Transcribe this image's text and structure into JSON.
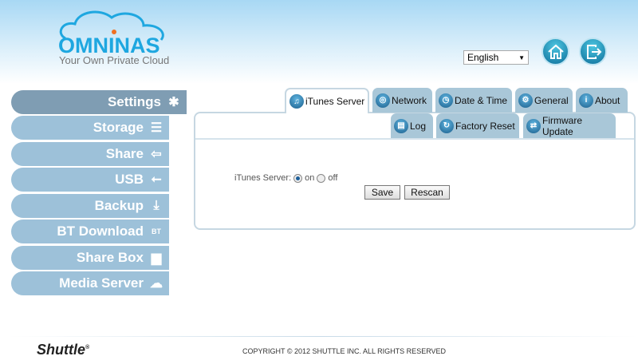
{
  "header": {
    "logo_text": "OMNINAS",
    "tagline": "Your Own Private Cloud",
    "language": "English",
    "home_icon": "home-icon",
    "logout_icon": "logout-icon"
  },
  "sidebar": {
    "items": [
      {
        "label": "Settings",
        "icon": "tools-icon",
        "active": true
      },
      {
        "label": "Storage",
        "icon": "storage-icon"
      },
      {
        "label": "Share",
        "icon": "share-arrow-icon"
      },
      {
        "label": "USB",
        "icon": "usb-icon"
      },
      {
        "label": "Backup",
        "icon": "backup-icon"
      },
      {
        "label": "BT Download",
        "icon": "bt-download-icon"
      },
      {
        "label": "Share Box",
        "icon": "share-box-icon"
      },
      {
        "label": "Media Server",
        "icon": "media-server-icon"
      }
    ]
  },
  "tabs": {
    "row1": [
      {
        "label": "iTunes Server",
        "active": true
      },
      {
        "label": "Network"
      },
      {
        "label": "Date & Time"
      },
      {
        "label": "General"
      },
      {
        "label": "About"
      }
    ],
    "row2": [
      {
        "label": "Log"
      },
      {
        "label": "Factory Reset"
      },
      {
        "label": "Firmware Update"
      }
    ]
  },
  "form": {
    "label": "iTunes Server:",
    "on_label": "on",
    "off_label": "off",
    "selected": "on",
    "save": "Save",
    "rescan": "Rescan"
  },
  "footer": {
    "brand": "Shuttle",
    "reg": "®",
    "copyright": "COPYRIGHT © 2012 SHUTTLE INC. ALL RIGHTS RESERVED"
  },
  "colors": {
    "sidebar_active": "#7f9db3",
    "sidebar": "#9dc1d9",
    "tab": "#a9c7d8",
    "brand_blue": "#1ea7e0"
  }
}
